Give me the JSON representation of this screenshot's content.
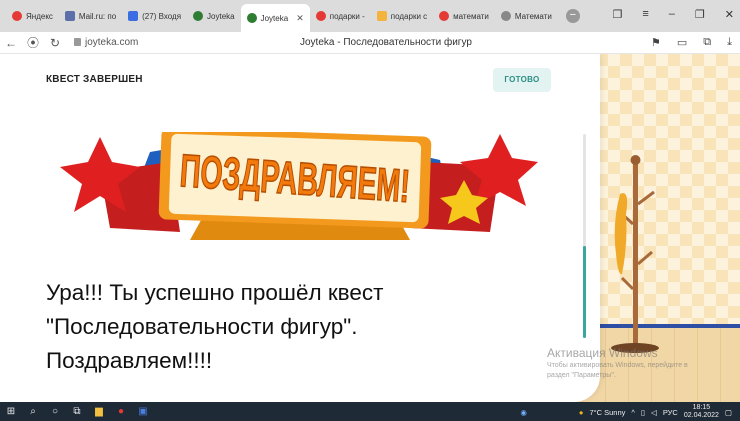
{
  "browser": {
    "tabs": [
      {
        "label": "Яндекс",
        "color": "#e53935"
      },
      {
        "label": "Mail.ru: по",
        "color": "#5b6fa8"
      },
      {
        "label": "(27) Входя",
        "color": "#3b6ee0"
      },
      {
        "label": "Joyteka",
        "color": "#2e7d32"
      },
      {
        "label": "Joyteka",
        "color": "#2e7d32",
        "active": true
      },
      {
        "label": "подарки -",
        "color": "#e53935"
      },
      {
        "label": "подарки с",
        "color": "#f3b33d"
      },
      {
        "label": "математи",
        "color": "#e53935"
      },
      {
        "label": "Математи",
        "color": "#888888"
      }
    ],
    "url": "joyteka.com",
    "page_title": "Joyteka - Последовательности фигур"
  },
  "panel": {
    "title": "КВЕСТ ЗАВЕРШЕН",
    "done_label": "ГОТОВО",
    "banner_text": "ПОЗДРАВЛЯЕМ!",
    "message_lines": [
      "Ура!!! Ты успешно прошёл квест",
      "\"Последовательности фигур\".",
      "Поздравляем!!!!"
    ]
  },
  "watermark": {
    "title": "Активация Windows",
    "sub_lines": [
      "Чтобы активировать Windows, перейдите в",
      "раздел \"Параметры\"."
    ]
  },
  "taskbar": {
    "weather": "7°C  Sunny",
    "lang": "РУС",
    "time": "18:15",
    "date": "02.04.2022"
  },
  "colors": {
    "accent": "#3aa79c",
    "done_bg": "#e3f3f1"
  }
}
